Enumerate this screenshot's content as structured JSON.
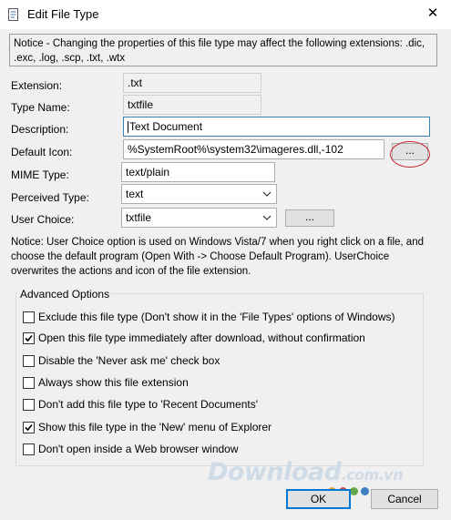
{
  "window": {
    "title": "Edit File Type",
    "close_glyph": "✕",
    "icon": "file-edit-icon"
  },
  "notice": "Notice - Changing the properties of this file type may affect the following extensions: .dic, .exc, .log, .scp, .txt, .wtx",
  "fields": {
    "extension": {
      "label": "Extension:",
      "value": ".txt"
    },
    "type_name": {
      "label": "Type Name:",
      "value": "txtfile"
    },
    "description": {
      "label": "Description:",
      "value": "Text Document"
    },
    "default_icon": {
      "label": "Default Icon:",
      "value": "%SystemRoot%\\system32\\imageres.dll,-102",
      "browse_label": "..."
    },
    "mime_type": {
      "label": "MIME Type:",
      "value": "text/plain"
    },
    "perceived_type": {
      "label": "Perceived Type:",
      "value": "text"
    },
    "user_choice": {
      "label": "User Choice:",
      "value": "txtfile",
      "browse_label": "..."
    }
  },
  "user_choice_note": "Notice: User Choice option is used on Windows Vista/7 when you right click on a file, and choose the default program (Open With -> Choose Default Program). UserChoice overwrites the actions and icon of the file extension.",
  "advanced": {
    "label": "Advanced Options",
    "options": [
      {
        "label": "Exclude  this file type (Don't show it in the 'File Types' options of Windows)",
        "checked": false
      },
      {
        "label": "Open this file type immediately after download, without confirmation",
        "checked": true
      },
      {
        "label": "Disable the 'Never ask me' check box",
        "checked": false
      },
      {
        "label": "Always show this file extension",
        "checked": false
      },
      {
        "label": "Don't add this file type to 'Recent Documents'",
        "checked": false
      },
      {
        "label": "Show this file type in the 'New' menu of Explorer",
        "checked": true
      },
      {
        "label": "Don't open inside a Web browser window",
        "checked": false
      }
    ]
  },
  "buttons": {
    "ok": "OK",
    "cancel": "Cancel"
  },
  "watermark": {
    "main": "Download",
    "suffix": ".com.vn",
    "dot_colors": [
      "#e2a12b",
      "#d8473c",
      "#6aa84f",
      "#3d7fc1"
    ]
  }
}
